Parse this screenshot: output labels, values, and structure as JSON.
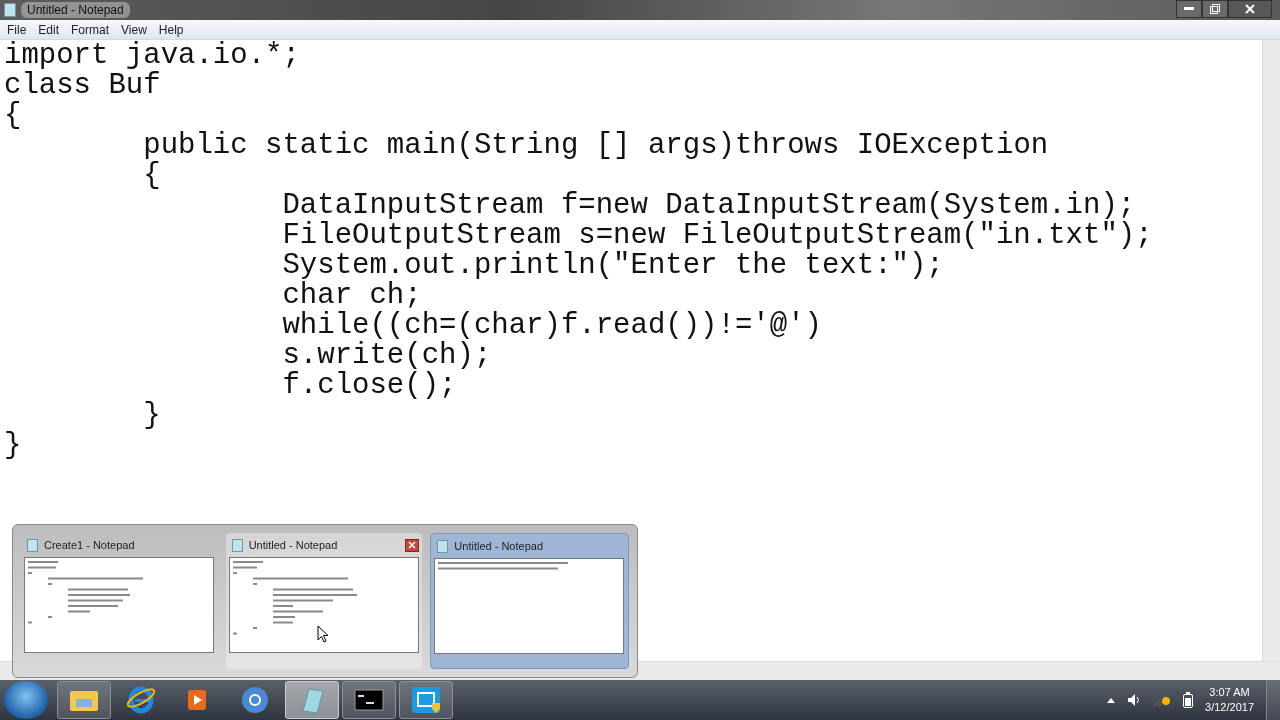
{
  "window": {
    "title": "Untitled - Notepad"
  },
  "menu": [
    "File",
    "Edit",
    "Format",
    "View",
    "Help"
  ],
  "editor": {
    "lines": [
      "import java.io.*;",
      "class Buf",
      "{",
      "\tpublic static main(String [] args)throws IOException",
      "\t{",
      "\t\tDataInputStream f=new DataInputStream(System.in);",
      "\t\tFileOutputStream s=new FileOutputStream(\"in.txt\");",
      "\t\tSystem.out.println(\"Enter the text:\");",
      "\t\tchar ch;",
      "\t\twhile((ch=(char)f.read())!='@')",
      "\t\ts.write(ch);",
      "\t\tf.close();",
      "\t}",
      "}"
    ]
  },
  "thumbnails": [
    {
      "title": "Create1 - Notepad",
      "selected": false,
      "hovered": false
    },
    {
      "title": "Untitled - Notepad",
      "selected": false,
      "hovered": true
    },
    {
      "title": "Untitled - Notepad",
      "selected": true,
      "hovered": false
    }
  ],
  "taskbar": [
    {
      "kind": "folder",
      "running": true,
      "active": false
    },
    {
      "kind": "browser-e",
      "running": false,
      "active": false
    },
    {
      "kind": "media",
      "running": false,
      "active": false
    },
    {
      "kind": "chrome",
      "running": false,
      "active": false
    },
    {
      "kind": "notepad",
      "running": true,
      "active": true
    },
    {
      "kind": "terminal",
      "running": true,
      "active": false
    },
    {
      "kind": "capture",
      "running": true,
      "active": false
    }
  ],
  "clock": {
    "time": "3:07 AM",
    "date": "3/12/2017"
  }
}
